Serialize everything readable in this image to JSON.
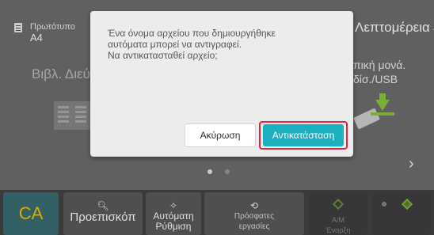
{
  "header": {
    "original_label": "Πρωτότυπο",
    "original_size": "A4",
    "details_label": "Λεπτομέρεια"
  },
  "modes": {
    "left_label": "Βιβλ. Διεύ",
    "right_label_line1": "πική μονά.",
    "right_label_line2": "δίσ./USB"
  },
  "icons": {
    "original": "document-icon",
    "book": "book-icon",
    "usb": "usb-download-icon",
    "next": "chevron-right-icon",
    "preview": "magnifier-icon",
    "auto": "sparkle-icon",
    "recent": "history-icon",
    "start": "start-diamond-icon"
  },
  "pager": {
    "pages": 2,
    "current": 1
  },
  "bottom_bar": {
    "ca_label": "CA",
    "preview_label": "Προεπισκόπ",
    "auto_label_line1": "Αυτόματη",
    "auto_label_line2": "Ρύθμιση",
    "recent_label_line1": "Πρόσφατες",
    "recent_label_line2": "εργασίες",
    "bw_label_line1": "Α/Μ",
    "bw_label_line2": "Έναρξη"
  },
  "dialog": {
    "message_line1": "Ένα όνομα αρχείου που δημιουργήθηκε",
    "message_line2": "αυτόματα μπορεί να αντιγραφεί.",
    "message_line3": "Να αντικατασταθεί αρχείο;",
    "cancel_label": "Ακύρωση",
    "replace_label": "Αντικατάσταση"
  },
  "colors": {
    "accent": "#1ab0bf",
    "highlight": "#e52238",
    "ca_text": "#f7c300",
    "start_green": "#7fb33f"
  }
}
